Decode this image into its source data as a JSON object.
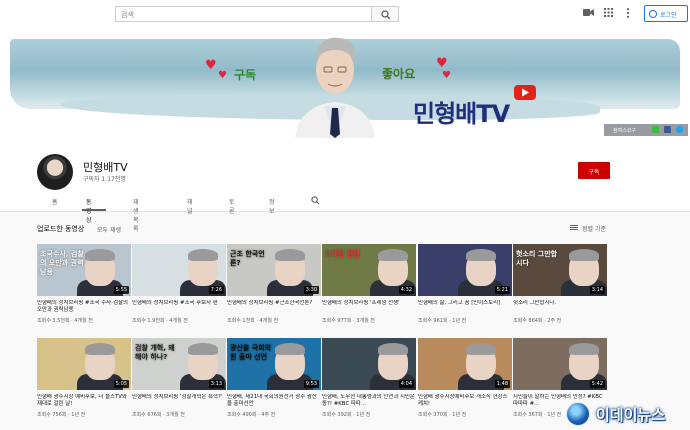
{
  "search": {
    "placeholder": "검색"
  },
  "header": {
    "login_label": "로그인"
  },
  "banner": {
    "subscribe_text": "구독",
    "like_text": "좋아요",
    "logo_text": "민형배TV",
    "social_text": "참여스코구",
    "colors": {
      "heart": "#e0243c",
      "logo": "#1f2f7a",
      "sky": "#8cb7c6"
    }
  },
  "channel": {
    "name": "민형배TV",
    "subscribers": "구독자 1.17천명",
    "subscribe_button": "구독"
  },
  "tabs": [
    {
      "label": "홈"
    },
    {
      "label": "동영상",
      "active": true
    },
    {
      "label": "재생목록"
    },
    {
      "label": "채널"
    },
    {
      "label": "토론"
    },
    {
      "label": "정보"
    }
  ],
  "section": {
    "title": "업로드한 동영상",
    "play_all": "모두 재생",
    "sort_label": "정렬 기준"
  },
  "videos_row1": [
    {
      "title": "민형배의 정치브리핑 #조국 수사-검찰의 오만과 권력남용",
      "meta": "조회수 3.5천회 · 4개월 전",
      "duration": "5:55",
      "caption": "조국수사, 검찰의 오만과 권력 남용",
      "bg": "#b9c6cf"
    },
    {
      "title": "민형배의 정치브리핑 #조국 후보자 편",
      "meta": "조회수 1.9천회 · 4개월 전",
      "duration": "7:26",
      "caption": "",
      "bg": "#d6e0e2"
    },
    {
      "title": "민형배의 정치브리핑 #근조한국언론?",
      "meta": "조회수 1천회 · 4개월 전",
      "duration": "3:30",
      "caption": "근조 한국언론?",
      "bg": "#c8c9c4"
    },
    {
      "title": "민형배의 정치브리핑 '프레임 전쟁'",
      "meta": "조회수 977회 · 3개월 전",
      "duration": "4:32",
      "caption": "프레임 전쟁",
      "bg": "#6f7a46"
    },
    {
      "title": "민형배의 삶, 그리고 꿈 [민이스토리]",
      "meta": "조회수 961회 · 1년 전",
      "duration": "5:21",
      "caption": "",
      "bg": "#3a3f6a"
    },
    {
      "title": "헛소리 그만합시다.",
      "meta": "조회수 864회 · 2주 전",
      "duration": "3:14",
      "caption": "헛소리 그만합시다",
      "bg": "#5a4a3e"
    }
  ],
  "videos_row2": [
    {
      "title": "민형배 광주시장 예비후보, 더 플스TV와 재대로 걸린 날!",
      "meta": "조회수 756회 · 1년 전",
      "duration": "5:05",
      "caption": "",
      "bg": "#d7c28a"
    },
    {
      "title": "민형배의 정치브리핑 '검찰개혁은 특혁?'",
      "meta": "조회수 676회 · 3개월 전",
      "duration": "3:13",
      "caption": "검찰 개혁, 왜 해야 하나?",
      "bg": "#cfd1cf"
    },
    {
      "title": "민형배, 제21대 국회의원선거 광주 광산을 출마선언",
      "meta": "조회수 490회 · 4주 전",
      "duration": "9:53",
      "caption": "광산을 국회의원 출마 선언",
      "bg": "#1e72a8"
    },
    {
      "title": "민형배, 노무현 대통령과의 인연과 시민운동?! #KBC 따따...",
      "meta": "조회수 392회 · 1년 전",
      "duration": "4:04",
      "caption": "",
      "bg": "#3a4a54"
    },
    {
      "title": "민형배 광주시장예비후보 개소식 현장스케치!",
      "meta": "조회수 370회 · 1년 전",
      "duration": "1:48",
      "caption": "",
      "bg": "#b98a5c"
    },
    {
      "title": "지민들이 말하는 민형배의 민정? #KBC 따따따 #...",
      "meta": "조회수 367회 · 1년 전",
      "duration": "5:42",
      "caption": "",
      "bg": "#7c6d5e"
    }
  ],
  "watermark": {
    "text": "이데이뉴스"
  }
}
